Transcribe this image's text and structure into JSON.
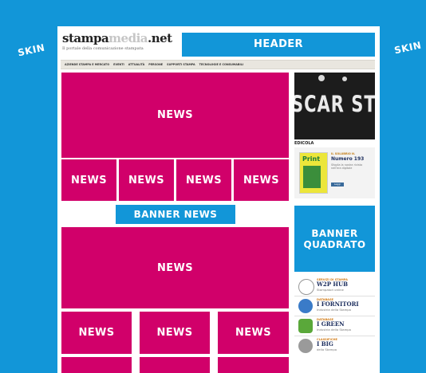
{
  "skin_left": "SKIN",
  "skin_right": "SKIN",
  "logo": {
    "main": "stampa",
    "accent": "media",
    "suffix": ".net",
    "tagline": "Il portale della comunicazione stampata"
  },
  "header_banner": "HEADER",
  "nav": [
    "AZIENDE STAMPA E MERCATO",
    "EVENTI",
    "ATTUALITÀ",
    "PERSONE",
    "SUPPORTI STAMPA",
    "TECNOLOGIE E CONSUMABILI"
  ],
  "news_label": "NEWS",
  "banner_news": "BANNER NEWS",
  "sidebar": {
    "photo_text": "SCAR STAM",
    "edicola_label": "EDICOLA",
    "edicola": {
      "small": "IL SOLUBRIO N.",
      "number": "Numero 193",
      "desc": "Sfoglia la nostra rivista nell'era digitale",
      "button": "Leggi",
      "cover_title": "Print"
    },
    "banner_quadrato": [
      "BANNER",
      "QUADRATO"
    ],
    "ads": [
      {
        "small": "SERVIZI DI STAMPA",
        "title": "W2P HUB",
        "sub": "Stampatori online",
        "icon": "w2p-hub-icon"
      },
      {
        "small": "DATABASE",
        "title": "I FORNITORI",
        "sub": "Industria della Stampa",
        "icon": "fornitori-icon"
      },
      {
        "small": "DATABASE",
        "title": "I GREEN",
        "sub": "Industria della Stampa",
        "icon": "green-icon"
      },
      {
        "small": "CLASSIFICHE",
        "title": "I BIG",
        "sub": "della Stampa",
        "icon": "big-icon"
      }
    ]
  },
  "colors": {
    "skin": "#1296d8",
    "news": "#d1006a",
    "banner": "#1296d8"
  }
}
